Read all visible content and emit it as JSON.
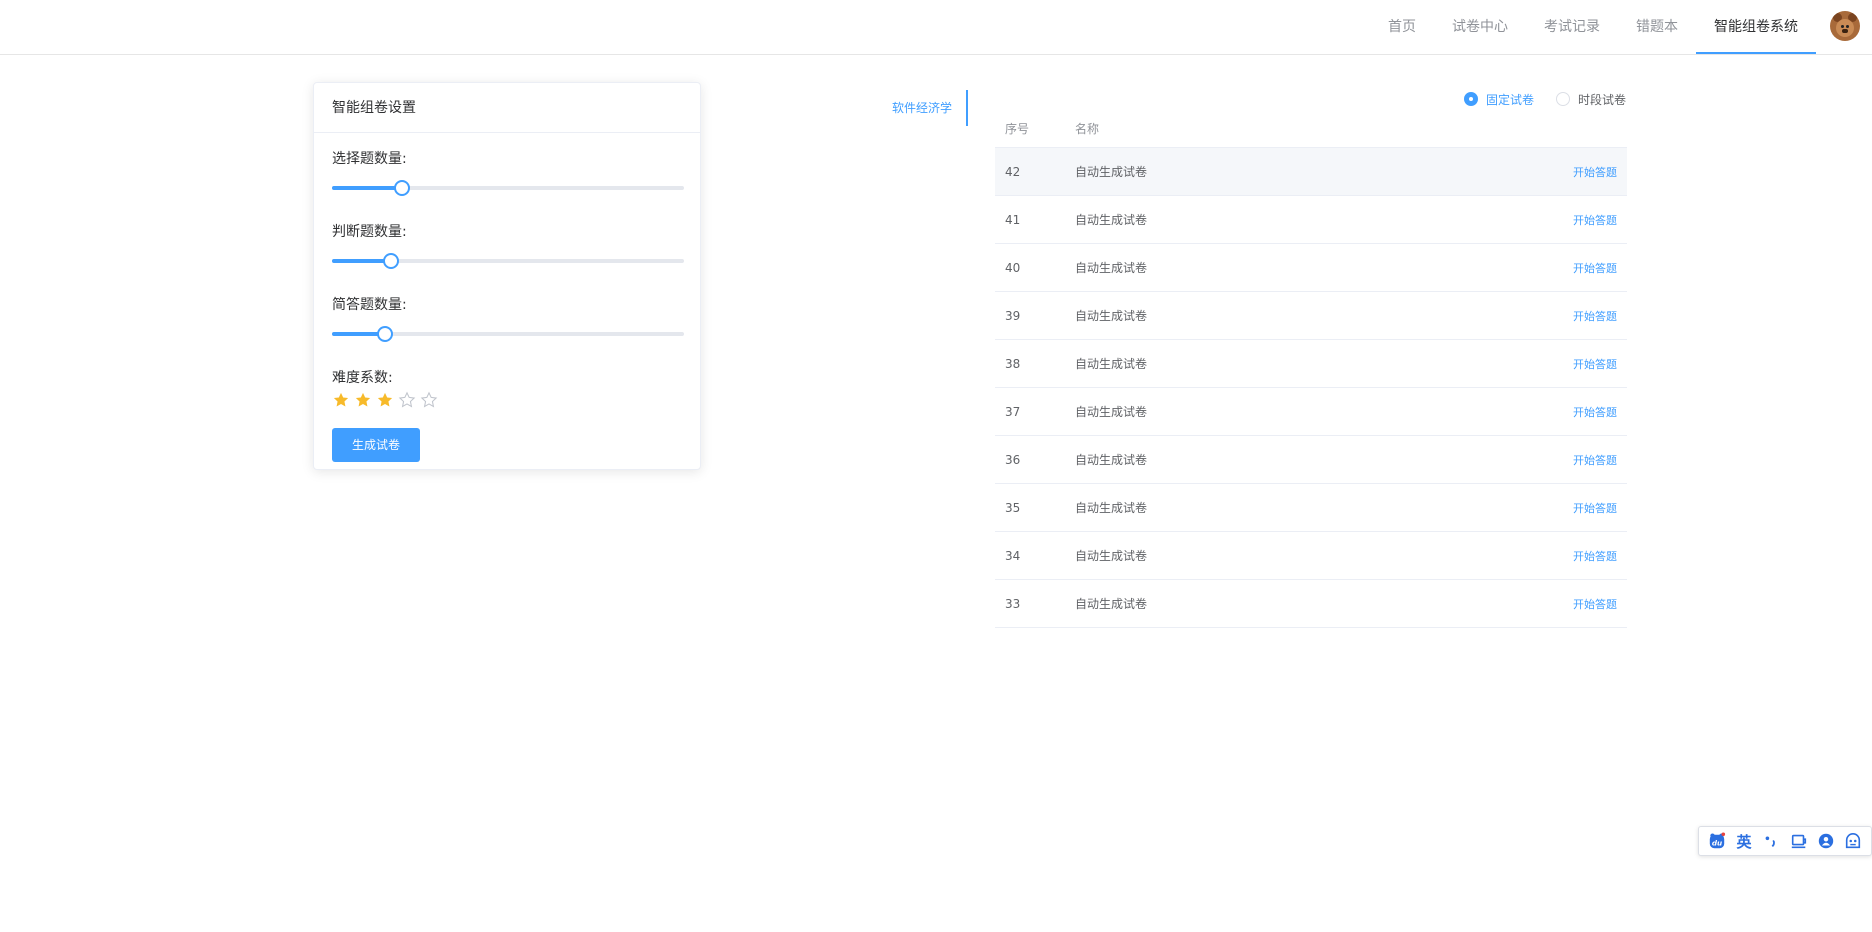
{
  "nav": {
    "items": [
      "首页",
      "试卷中心",
      "考试记录",
      "错题本",
      "智能组卷系统"
    ],
    "active_index": 4
  },
  "settings": {
    "title": "智能组卷设置",
    "choice": {
      "label": "选择题数量:",
      "value_fraction": 0.2
    },
    "judge": {
      "label": "判断题数量:",
      "value_fraction": 0.167
    },
    "short": {
      "label": "简答题数量:",
      "value_fraction": 0.15
    },
    "difficulty": {
      "label": "难度系数:",
      "value": 3,
      "max": 5
    },
    "generate_button": "生成试卷"
  },
  "subject_tab": "软件经济学",
  "paper_type": {
    "options": [
      "固定试卷",
      "时段试卷"
    ],
    "selected_index": 0
  },
  "table": {
    "headers": [
      "序号",
      "名称",
      ""
    ],
    "rows": [
      {
        "id": "42",
        "name": "自动生成试卷",
        "action": "开始答题"
      },
      {
        "id": "41",
        "name": "自动生成试卷",
        "action": "开始答题"
      },
      {
        "id": "40",
        "name": "自动生成试卷",
        "action": "开始答题"
      },
      {
        "id": "39",
        "name": "自动生成试卷",
        "action": "开始答题"
      },
      {
        "id": "38",
        "name": "自动生成试卷",
        "action": "开始答题"
      },
      {
        "id": "37",
        "name": "自动生成试卷",
        "action": "开始答题"
      },
      {
        "id": "36",
        "name": "自动生成试卷",
        "action": "开始答题"
      },
      {
        "id": "35",
        "name": "自动生成试卷",
        "action": "开始答题"
      },
      {
        "id": "34",
        "name": "自动生成试卷",
        "action": "开始答题"
      },
      {
        "id": "33",
        "name": "自动生成试卷",
        "action": "开始答题"
      }
    ],
    "hover_row_index": 0
  },
  "ime": {
    "lang": "英",
    "icons": [
      "baidu-logo-icon",
      "punctuation-icon",
      "keyboard-icon",
      "skin-icon",
      "more-icon"
    ]
  },
  "colors": {
    "accent": "#409eff",
    "star_on": "#f7ba2a",
    "star_off": "#c0c4cc"
  }
}
